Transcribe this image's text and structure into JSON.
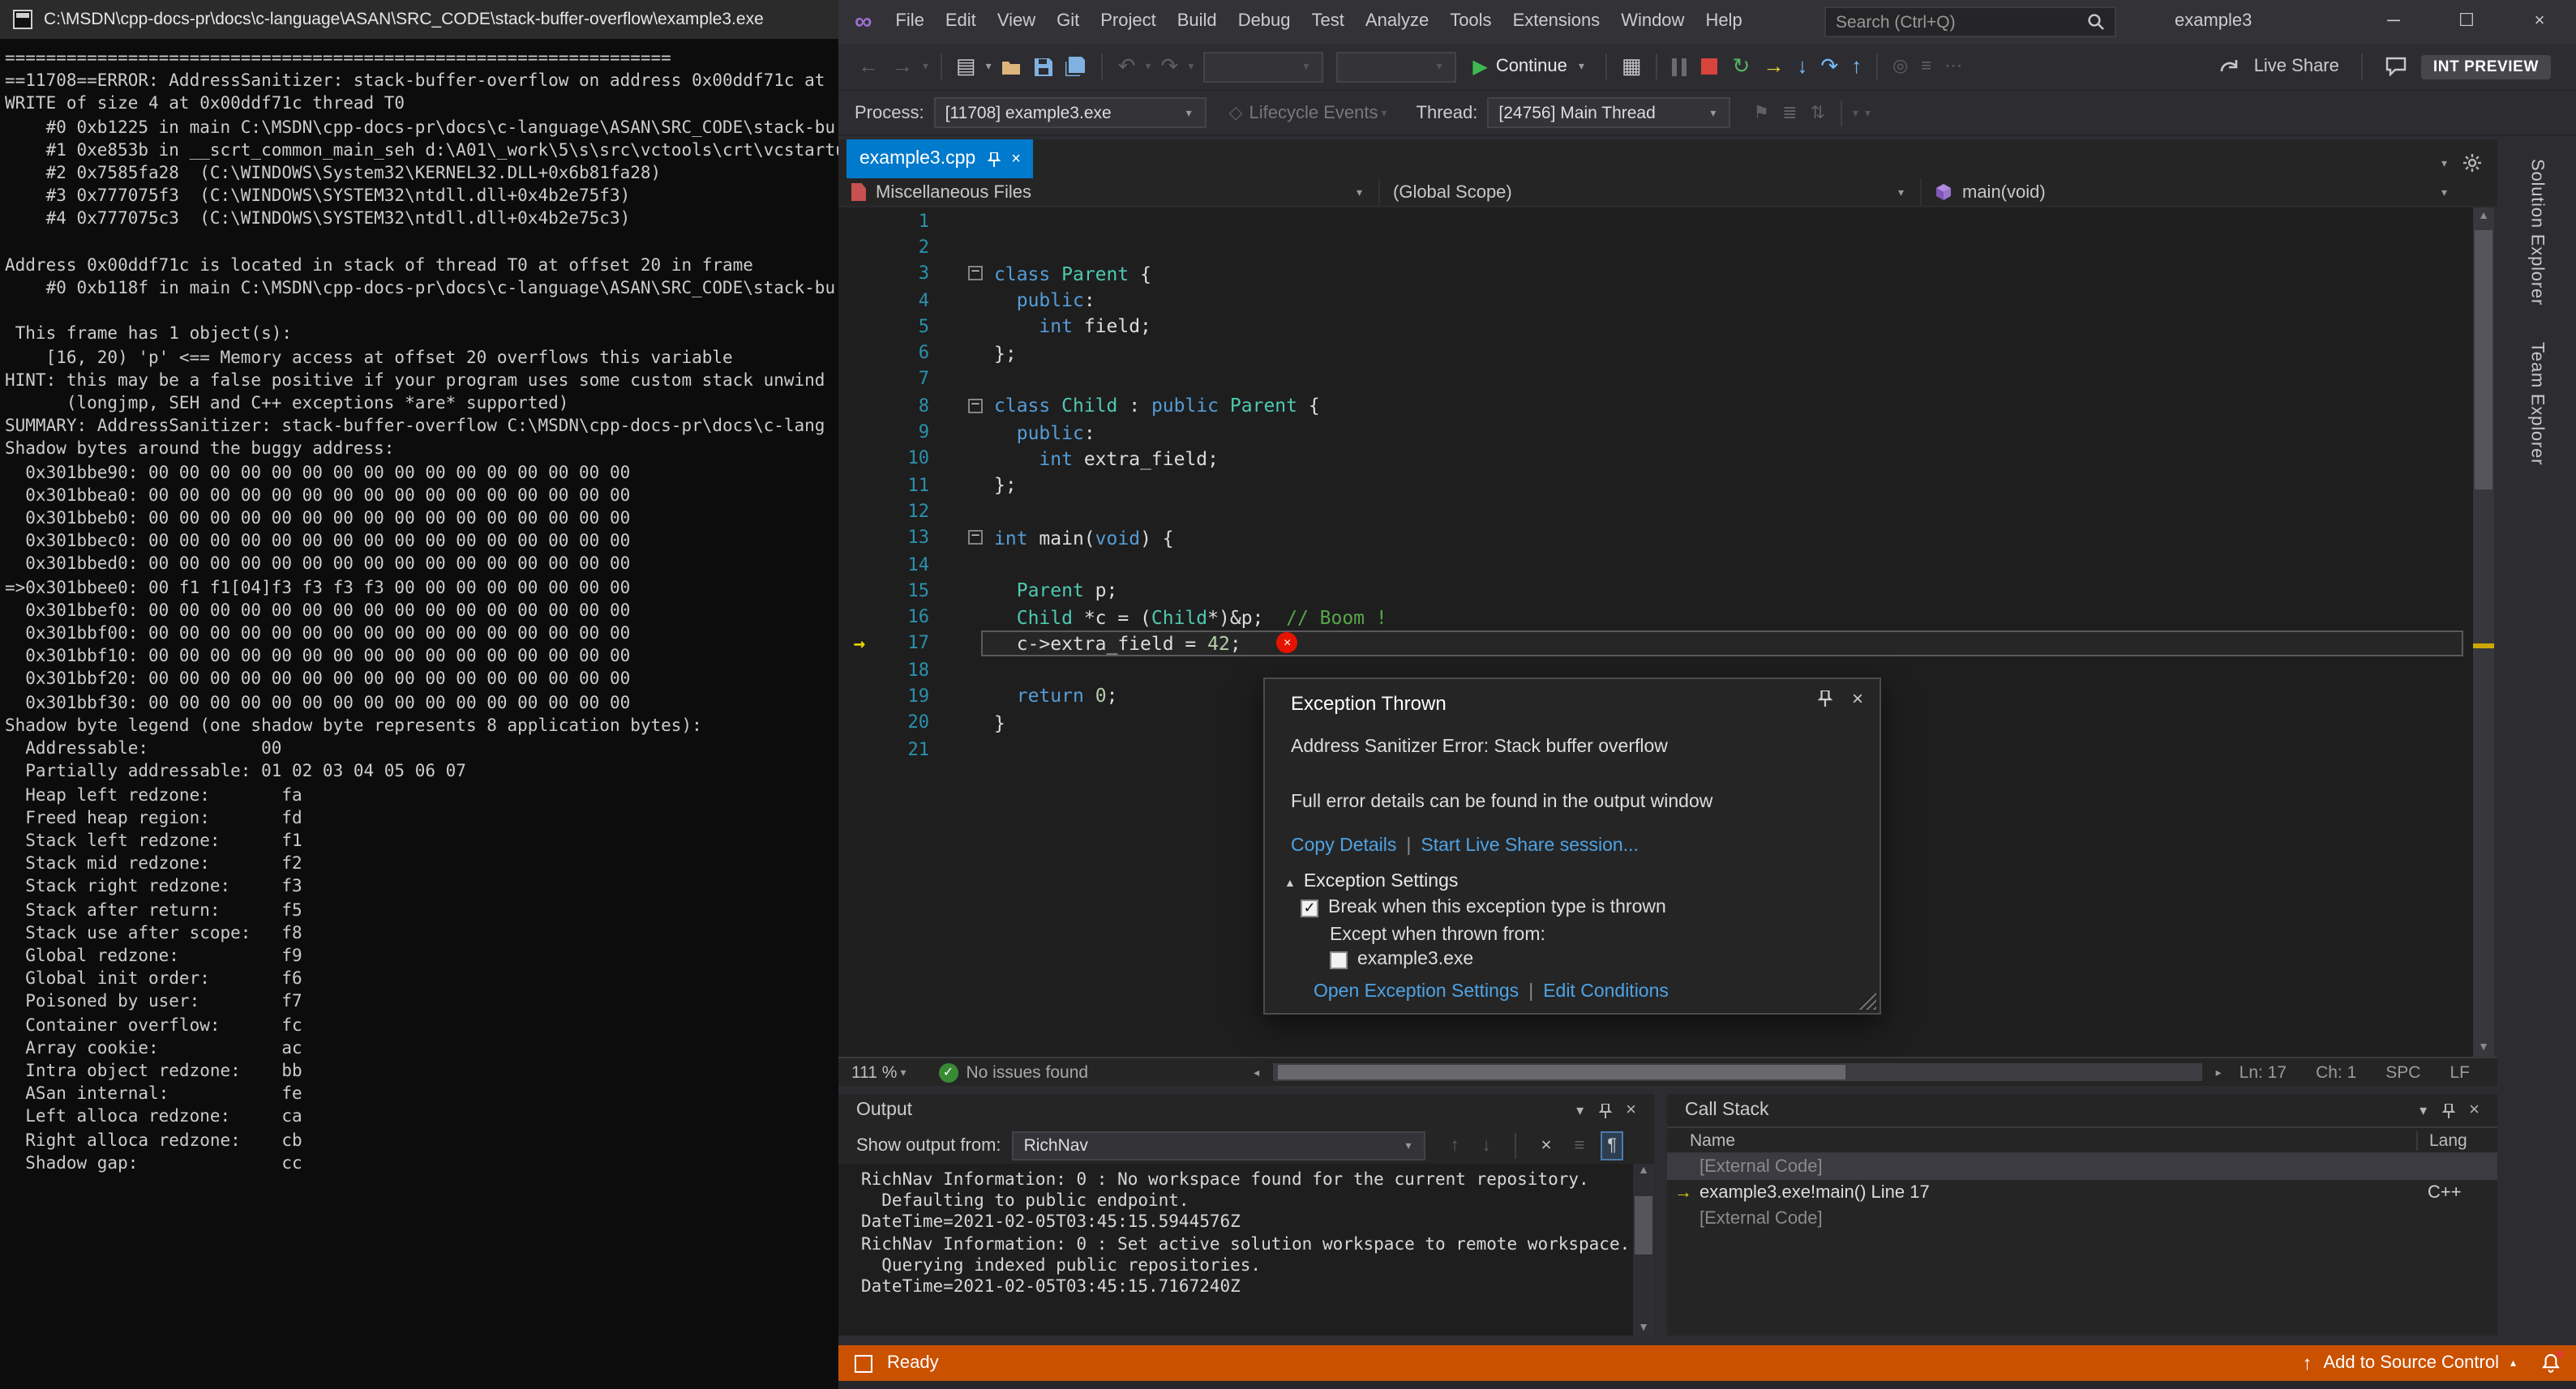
{
  "colors": {
    "accent_blue": "#007acc",
    "status_orange": "#ca5100",
    "link_blue": "#4fa3e3",
    "error_red": "#e51400",
    "run_green": "#3fba53",
    "keyword_blue": "#569cd6",
    "type_teal": "#4ec9b0",
    "comment_green": "#57a64a",
    "number_green": "#b5cea8",
    "line_number_blue": "#2b91af",
    "current_statement_yellow": "#e8d402"
  },
  "console": {
    "title": "C:\\MSDN\\cpp-docs-pr\\docs\\c-language\\ASAN\\SRC_CODE\\stack-buffer-overflow\\example3.exe",
    "lines": [
      "=================================================================",
      "==11708==ERROR: AddressSanitizer: stack-buffer-overflow on address 0x00ddf71c at",
      "WRITE of size 4 at 0x00ddf71c thread T0",
      "    #0 0xb1225 in main C:\\MSDN\\cpp-docs-pr\\docs\\c-language\\ASAN\\SRC_CODE\\stack-bu",
      "    #1 0xe853b in __scrt_common_main_seh d:\\A01\\_work\\5\\s\\src\\vctools\\crt\\vcstartu",
      "    #2 0x7585fa28  (C:\\WINDOWS\\System32\\KERNEL32.DLL+0x6b81fa28)",
      "    #3 0x777075f3  (C:\\WINDOWS\\SYSTEM32\\ntdll.dll+0x4b2e75f3)",
      "    #4 0x777075c3  (C:\\WINDOWS\\SYSTEM32\\ntdll.dll+0x4b2e75c3)",
      "",
      "Address 0x00ddf71c is located in stack of thread T0 at offset 20 in frame",
      "    #0 0xb118f in main C:\\MSDN\\cpp-docs-pr\\docs\\c-language\\ASAN\\SRC_CODE\\stack-bu",
      "",
      " This frame has 1 object(s):",
      "    [16, 20) 'p' <== Memory access at offset 20 overflows this variable",
      "HINT: this may be a false positive if your program uses some custom stack unwind",
      "      (longjmp, SEH and C++ exceptions *are* supported)",
      "SUMMARY: AddressSanitizer: stack-buffer-overflow C:\\MSDN\\cpp-docs-pr\\docs\\c-lang",
      "Shadow bytes around the buggy address:",
      "  0x301bbe90: 00 00 00 00 00 00 00 00 00 00 00 00 00 00 00 00",
      "  0x301bbea0: 00 00 00 00 00 00 00 00 00 00 00 00 00 00 00 00",
      "  0x301bbeb0: 00 00 00 00 00 00 00 00 00 00 00 00 00 00 00 00",
      "  0x301bbec0: 00 00 00 00 00 00 00 00 00 00 00 00 00 00 00 00",
      "  0x301bbed0: 00 00 00 00 00 00 00 00 00 00 00 00 00 00 00 00",
      "=>0x301bbee0: 00 f1 f1[04]f3 f3 f3 f3 00 00 00 00 00 00 00 00",
      "  0x301bbef0: 00 00 00 00 00 00 00 00 00 00 00 00 00 00 00 00",
      "  0x301bbf00: 00 00 00 00 00 00 00 00 00 00 00 00 00 00 00 00",
      "  0x301bbf10: 00 00 00 00 00 00 00 00 00 00 00 00 00 00 00 00",
      "  0x301bbf20: 00 00 00 00 00 00 00 00 00 00 00 00 00 00 00 00",
      "  0x301bbf30: 00 00 00 00 00 00 00 00 00 00 00 00 00 00 00 00",
      "Shadow byte legend (one shadow byte represents 8 application bytes):",
      "  Addressable:           00",
      "  Partially addressable: 01 02 03 04 05 06 07",
      "  Heap left redzone:       fa",
      "  Freed heap region:       fd",
      "  Stack left redzone:      f1",
      "  Stack mid redzone:       f2",
      "  Stack right redzone:     f3",
      "  Stack after return:      f5",
      "  Stack use after scope:   f8",
      "  Global redzone:          f9",
      "  Global init order:       f6",
      "  Poisoned by user:        f7",
      "  Container overflow:      fc",
      "  Array cookie:            ac",
      "  Intra object redzone:    bb",
      "  ASan internal:           fe",
      "  Left alloca redzone:     ca",
      "  Right alloca redzone:    cb",
      "  Shadow gap:              cc"
    ]
  },
  "vs": {
    "titlebar": {
      "menus": [
        "File",
        "Edit",
        "View",
        "Git",
        "Project",
        "Build",
        "Debug",
        "Test",
        "Analyze",
        "Tools",
        "Extensions",
        "Window",
        "Help"
      ],
      "search_placeholder": "Search (Ctrl+Q)",
      "window_title": "example3"
    },
    "toolbar": {
      "continue_label": "Continue",
      "live_share_label": "Live Share",
      "preview_badge": "INT PREVIEW"
    },
    "debugbar": {
      "process_label": "Process:",
      "process_value": "[11708] example3.exe",
      "lifecycle_label": "Lifecycle Events",
      "thread_label": "Thread:",
      "thread_value": "[24756] Main Thread"
    },
    "tabs": {
      "active_tab": "example3.cpp"
    },
    "navbar": {
      "dropdowns": [
        {
          "label": "Miscellaneous Files"
        },
        {
          "label": "(Global Scope)"
        },
        {
          "label": "main(void)"
        }
      ]
    },
    "editor": {
      "lines": [
        {
          "n": 1,
          "tokens": []
        },
        {
          "n": 2,
          "tokens": []
        },
        {
          "n": 3,
          "fold": true,
          "tokens": [
            [
              "k",
              "class"
            ],
            [
              "p",
              " "
            ],
            [
              "t",
              "Parent"
            ],
            [
              "p",
              " {"
            ]
          ]
        },
        {
          "n": 4,
          "tokens": [
            [
              "p",
              "  "
            ],
            [
              "k",
              "public"
            ],
            [
              "p",
              ":"
            ]
          ]
        },
        {
          "n": 5,
          "tokens": [
            [
              "p",
              "    "
            ],
            [
              "k",
              "int"
            ],
            [
              "p",
              " field;"
            ]
          ]
        },
        {
          "n": 6,
          "tokens": [
            [
              "p",
              "};"
            ]
          ]
        },
        {
          "n": 7,
          "tokens": []
        },
        {
          "n": 8,
          "fold": true,
          "tokens": [
            [
              "k",
              "class"
            ],
            [
              "p",
              " "
            ],
            [
              "t",
              "Child"
            ],
            [
              "p",
              " : "
            ],
            [
              "k",
              "public"
            ],
            [
              "p",
              " "
            ],
            [
              "t",
              "Parent"
            ],
            [
              "p",
              " {"
            ]
          ]
        },
        {
          "n": 9,
          "tokens": [
            [
              "p",
              "  "
            ],
            [
              "k",
              "public"
            ],
            [
              "p",
              ":"
            ]
          ]
        },
        {
          "n": 10,
          "tokens": [
            [
              "p",
              "    "
            ],
            [
              "k",
              "int"
            ],
            [
              "p",
              " extra_field;"
            ]
          ]
        },
        {
          "n": 11,
          "tokens": [
            [
              "p",
              "};"
            ]
          ]
        },
        {
          "n": 12,
          "tokens": []
        },
        {
          "n": 13,
          "fold": true,
          "tokens": [
            [
              "k",
              "int"
            ],
            [
              "p",
              " main("
            ],
            [
              "k",
              "void"
            ],
            [
              "p",
              ") {"
            ]
          ]
        },
        {
          "n": 14,
          "tokens": []
        },
        {
          "n": 15,
          "tokens": [
            [
              "p",
              "  "
            ],
            [
              "t",
              "Parent"
            ],
            [
              "p",
              " p;"
            ]
          ]
        },
        {
          "n": 16,
          "tokens": [
            [
              "p",
              "  "
            ],
            [
              "t",
              "Child"
            ],
            [
              "p",
              " *c = ("
            ],
            [
              "t",
              "Child"
            ],
            [
              "p",
              "*)&p;  "
            ],
            [
              "c",
              "// Boom !"
            ]
          ]
        },
        {
          "n": 17,
          "current": true,
          "arrow": true,
          "error": true,
          "tokens": [
            [
              "p",
              "  c->extra_field = "
            ],
            [
              "num",
              "42"
            ],
            [
              "p",
              ";"
            ]
          ]
        },
        {
          "n": 18,
          "tokens": []
        },
        {
          "n": 19,
          "tokens": [
            [
              "p",
              "  "
            ],
            [
              "k",
              "return"
            ],
            [
              "p",
              " "
            ],
            [
              "num",
              "0"
            ],
            [
              "p",
              ";"
            ]
          ]
        },
        {
          "n": 20,
          "tokens": [
            [
              "p",
              "}"
            ]
          ]
        },
        {
          "n": 21,
          "tokens": []
        }
      ],
      "status": {
        "zoom": "111 %",
        "issues": "No issues found",
        "line": "Ln: 17",
        "column": "Ch: 1",
        "insert_mode": "SPC",
        "line_ending": "LF"
      }
    },
    "exception": {
      "title": "Exception Thrown",
      "message": "Address Sanitizer Error: Stack buffer overflow",
      "details": "Full error details can be found in the output window",
      "copy_details": "Copy Details",
      "start_live_share": "Start Live Share session...",
      "settings_header": "Exception Settings",
      "break_label": "Break when this exception type is thrown",
      "except_label": "Except when thrown from:",
      "module_label": "example3.exe",
      "open_settings": "Open Exception Settings",
      "edit_conditions": "Edit Conditions"
    },
    "output": {
      "title": "Output",
      "show_from_label": "Show output from:",
      "source": "RichNav",
      "lines": [
        "RichNav Information: 0 : No workspace found for the current repository.",
        "  Defaulting to public endpoint.",
        "DateTime=2021-02-05T03:45:15.5944576Z",
        "RichNav Information: 0 : Set active solution workspace to remote workspace.",
        "  Querying indexed public repositories.",
        "DateTime=2021-02-05T03:45:15.7167240Z"
      ]
    },
    "callstack": {
      "title": "Call Stack",
      "columns": [
        "Name",
        "Lang"
      ],
      "rows": [
        {
          "name": "[External Code]",
          "lang": "",
          "external": true,
          "selected": true
        },
        {
          "name": "example3.exe!main() Line 17",
          "lang": "C++",
          "current": true
        },
        {
          "name": "[External Code]",
          "lang": "",
          "external": true
        }
      ]
    },
    "side_tabs": [
      "Solution Explorer",
      "Team Explorer"
    ],
    "statusbar": {
      "ready": "Ready",
      "add_source_control": "Add to Source Control"
    }
  }
}
